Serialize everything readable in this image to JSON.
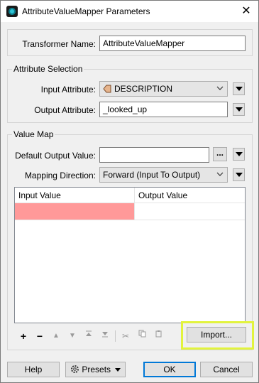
{
  "window": {
    "title": "AttributeValueMapper Parameters"
  },
  "transformer": {
    "label": "Transformer Name:",
    "value": "AttributeValueMapper"
  },
  "attribute_selection": {
    "group_label": "Attribute Selection",
    "input_label": "Input Attribute:",
    "input_value": "DESCRIPTION",
    "output_label": "Output Attribute:",
    "output_value": "_looked_up"
  },
  "value_map": {
    "group_label": "Value Map",
    "default_label": "Default Output Value:",
    "default_value": "",
    "dots_label": "...",
    "direction_label": "Mapping Direction:",
    "direction_value": "Forward (Input To Output)",
    "table": {
      "headers": [
        "Input Value",
        "Output Value"
      ],
      "rows": [
        [
          "",
          ""
        ]
      ]
    },
    "import_label": "Import..."
  },
  "footer": {
    "help": "Help",
    "presets": "Presets",
    "ok": "OK",
    "cancel": "Cancel"
  },
  "colors": {
    "invalid_cell": "#ff9999",
    "highlight": "#e2f33d",
    "accent": "#0078d7"
  }
}
